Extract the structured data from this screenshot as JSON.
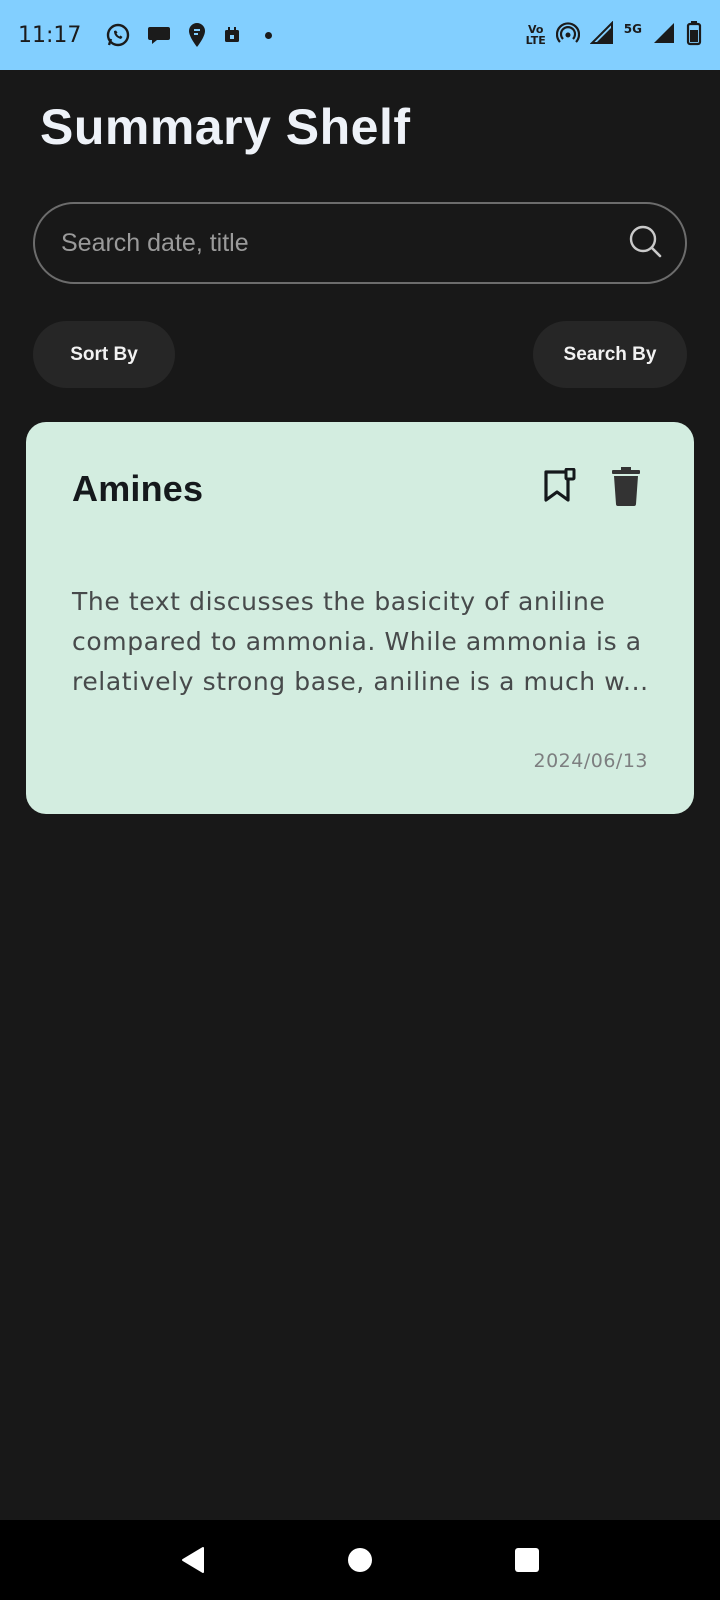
{
  "status_bar": {
    "time": "11:17",
    "volte_top": "Vo",
    "volte_bottom": "LTE",
    "network": "5G",
    "left_icons": [
      "whatsapp-icon",
      "chat-bubble-icon",
      "location-pin-icon",
      "calendar-icon"
    ],
    "right_icons": [
      "volte-icon",
      "hotspot-icon",
      "signal-icon",
      "signal-5g-icon",
      "battery-icon"
    ]
  },
  "header": {
    "title": "Summary Shelf"
  },
  "search": {
    "placeholder": "Search date, title",
    "value": ""
  },
  "filters": {
    "sort_label": "Sort By",
    "search_by_label": "Search By"
  },
  "cards": [
    {
      "title": "Amines",
      "summary": "The text discusses the basicity of aniline compared to ammonia. While ammonia is a relatively strong base, aniline is a much w...",
      "date": "2024/06/13",
      "icons": [
        "bookmark-icon",
        "trash-icon"
      ]
    }
  ],
  "colors": {
    "status_bar": "#82cfff",
    "background": "#181818",
    "card": "#d3ede0",
    "pill": "#262626"
  },
  "nav_bar": {
    "icons": [
      "back-icon",
      "home-icon",
      "recents-icon"
    ]
  }
}
